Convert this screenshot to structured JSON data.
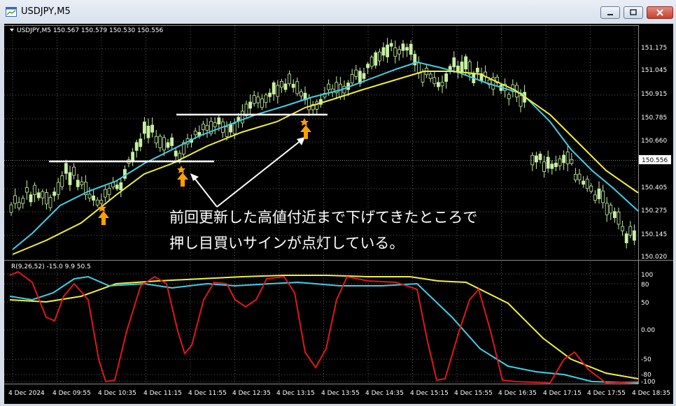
{
  "window": {
    "title": "USDJPY,M5"
  },
  "main_panel": {
    "header": "USDJPY,M5  150.567 150.579 150.530 150.556",
    "current_price": "150.556",
    "price_ticks": [
      "151.175",
      "151.045",
      "150.915",
      "150.785",
      "150.660",
      "150.405",
      "150.275",
      "150.145",
      "150.020"
    ],
    "annotation_lines": [
      "前回更新した高値付近まで下げてきたところで",
      "押し目買いサインが点灯している。"
    ]
  },
  "sub_panel": {
    "header": "R(9,26,52) -15.0 9.9 50.5",
    "ticks": [
      "100",
      "80",
      "50",
      "0.00",
      "-50",
      "-80",
      "-100"
    ]
  },
  "time_axis": [
    "4 Dec 2024",
    "4 Dec 09:55",
    "4 Dec 10:35",
    "4 Dec 11:15",
    "4 Dec 11:55",
    "4 Dec 12:35",
    "4 Dec 13:15",
    "4 Dec 13:55",
    "4 Dec 14:35",
    "4 Dec 15:15",
    "4 Dec 15:55",
    "4 Dec 16:35",
    "4 Dec 17:15",
    "4 Dec 17:55",
    "4 Dec 18:35"
  ],
  "colors": {
    "background": "#000000",
    "candle": "#c8f0a0",
    "ma_fast": "#40d0e8",
    "ma_slow": "#f0f040",
    "oscillator_red": "#e01818",
    "signal_arrow": "#ffa000",
    "level_line": "#ffffff"
  }
}
